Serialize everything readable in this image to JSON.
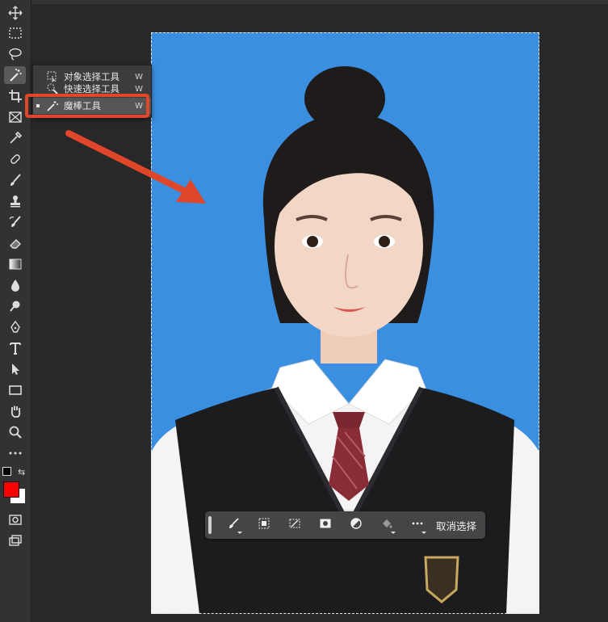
{
  "tool_flyout": {
    "items": [
      {
        "label": "对象选择工具",
        "shortcut": "W",
        "icon": "object-selection-icon"
      },
      {
        "label": "快速选择工具",
        "shortcut": "W",
        "icon": "quick-selection-icon"
      },
      {
        "label": "魔棒工具",
        "shortcut": "W",
        "icon": "magic-wand-icon",
        "selected": true
      }
    ]
  },
  "toolbar": {
    "tools": [
      "move-icon",
      "marquee-icon",
      "lasso-icon",
      "magic-wand-icon",
      "crop-icon",
      "frame-icon",
      "eyedropper-icon",
      "healing-icon",
      "brush-icon",
      "stamp-icon",
      "history-brush-icon",
      "eraser-icon",
      "gradient-icon",
      "blur-icon",
      "dodge-icon",
      "pen-icon",
      "type-icon",
      "path-selection-icon",
      "rectangle-icon",
      "hand-icon",
      "zoom-icon",
      "more-icon"
    ],
    "foreground_color": "#ff0000",
    "background_color": "#ffffff"
  },
  "contextual_bar": {
    "deselect_label": "取消选择"
  },
  "canvas": {
    "background_color": "#3a8fe0"
  },
  "annotation": {
    "highlight_color": "#e0462a"
  }
}
